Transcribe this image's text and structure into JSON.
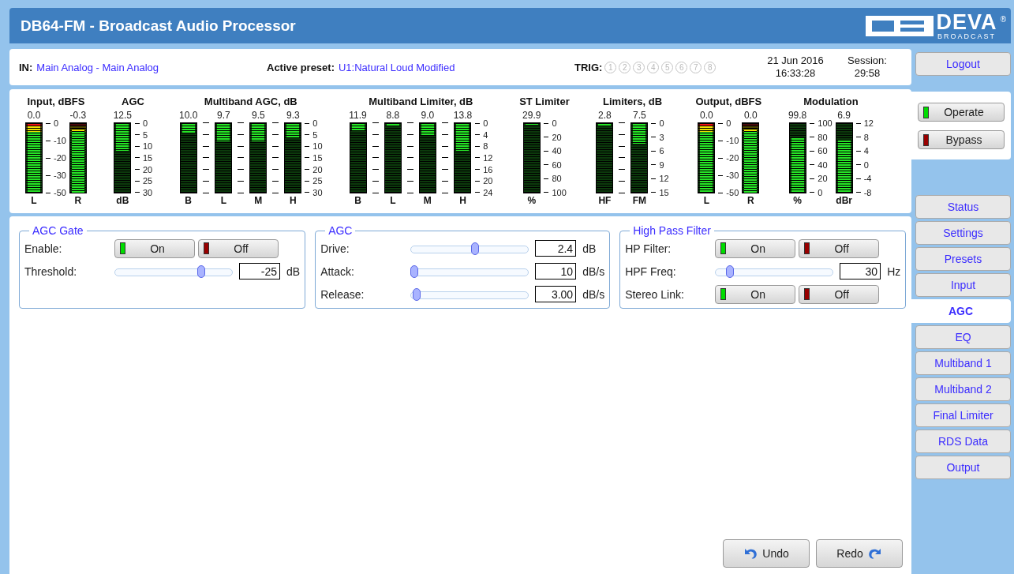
{
  "window": {
    "title": "DB64-FM - Broadcast Audio Processor"
  },
  "logo": {
    "name": "DEVA",
    "registered": "®",
    "tagline": "BROADCAST"
  },
  "info": {
    "input_label": "IN:",
    "input_value": "Main Analog - Main Analog",
    "preset_label": "Active preset:",
    "preset_value": "U1:Natural Loud Modified",
    "trig_label": "TRIG:",
    "triggers": [
      {
        "label": "1",
        "disabled": true
      },
      {
        "label": "2",
        "disabled": true
      },
      {
        "label": "3",
        "disabled": true
      },
      {
        "label": "4",
        "disabled": true
      },
      {
        "label": "5",
        "disabled": true
      },
      {
        "label": "6",
        "disabled": true
      },
      {
        "label": "7",
        "disabled": true
      },
      {
        "label": "8",
        "disabled": true
      }
    ],
    "date": "21 Jun 2016",
    "time": "16:33:28",
    "session_label": "Session:",
    "session_value": "29:58"
  },
  "meters": [
    {
      "title": "Input, dBFS",
      "columns": [
        {
          "kind": "clip",
          "value": "0.0",
          "label": "L",
          "level": 1.0
        },
        {
          "kind": "scale",
          "labels": [
            "0",
            "-10",
            "-20",
            "-30",
            "-50"
          ]
        },
        {
          "kind": "clip",
          "value": "-0.3",
          "label": "R",
          "level": 0.92
        }
      ]
    },
    {
      "title": "AGC",
      "columns": [
        {
          "kind": "drop",
          "value": "12.5",
          "label": "dB",
          "level": 0.4
        },
        {
          "kind": "scale",
          "labels": [
            "0",
            "5",
            "10",
            "15",
            "20",
            "25",
            "30"
          ]
        }
      ]
    },
    {
      "title": "Multiband AGC, dB",
      "columns": [
        {
          "kind": "drop",
          "value": "10.0",
          "label": "B",
          "level": 0.14
        },
        {
          "kind": "ticks"
        },
        {
          "kind": "drop",
          "value": "9.7",
          "label": "L",
          "level": 0.26
        },
        {
          "kind": "ticks"
        },
        {
          "kind": "drop",
          "value": "9.5",
          "label": "M",
          "level": 0.26
        },
        {
          "kind": "ticks"
        },
        {
          "kind": "drop",
          "value": "9.3",
          "label": "H",
          "level": 0.2
        },
        {
          "kind": "scale",
          "labels": [
            "0",
            "5",
            "10",
            "15",
            "20",
            "25",
            "30"
          ]
        }
      ]
    },
    {
      "title": "Multiband Limiter, dB",
      "columns": [
        {
          "kind": "drop",
          "value": "11.9",
          "label": "B",
          "level": 0.1
        },
        {
          "kind": "ticks"
        },
        {
          "kind": "drop",
          "value": "8.8",
          "label": "L",
          "level": 0.03
        },
        {
          "kind": "ticks"
        },
        {
          "kind": "drop",
          "value": "9.0",
          "label": "M",
          "level": 0.17
        },
        {
          "kind": "ticks"
        },
        {
          "kind": "drop",
          "value": "13.8",
          "label": "H",
          "level": 0.4
        },
        {
          "kind": "scale",
          "labels": [
            "0",
            "4",
            "8",
            "12",
            "16",
            "20",
            "24"
          ]
        }
      ]
    },
    {
      "title": "ST Limiter",
      "columns": [
        {
          "kind": "drop",
          "value": "29.9",
          "label": "%",
          "level": 0.02
        },
        {
          "kind": "scale",
          "labels": [
            "0",
            "20",
            "40",
            "60",
            "80",
            "100"
          ]
        }
      ]
    },
    {
      "title": "Limiters, dB",
      "columns": [
        {
          "kind": "drop",
          "value": "2.8",
          "label": "HF",
          "level": 0.05
        },
        {
          "kind": "ticks"
        },
        {
          "kind": "drop",
          "value": "7.5",
          "label": "FM",
          "level": 0.3
        },
        {
          "kind": "scale",
          "labels": [
            "0",
            "3",
            "6",
            "9",
            "12",
            "15"
          ]
        }
      ]
    },
    {
      "title": "Output, dBFS",
      "columns": [
        {
          "kind": "clip",
          "value": "0.0",
          "label": "L",
          "level": 1.0
        },
        {
          "kind": "scale",
          "labels": [
            "0",
            "-10",
            "-20",
            "-30",
            "-50"
          ]
        },
        {
          "kind": "clip",
          "value": "0.0",
          "label": "R",
          "level": 0.92
        }
      ]
    },
    {
      "title": "Modulation",
      "columns": [
        {
          "kind": "rise",
          "value": "99.8",
          "label": "%",
          "level": 0.8
        },
        {
          "kind": "scale",
          "labels": [
            "100",
            "80",
            "60",
            "40",
            "20",
            "0"
          ]
        },
        {
          "kind": "rise",
          "value": "6.9",
          "label": "dBr",
          "level": 0.76
        },
        {
          "kind": "scale",
          "labels": [
            "12",
            "8",
            "4",
            "0",
            "-4",
            "-8"
          ]
        }
      ]
    }
  ],
  "sections": [
    {
      "title": "AGC Gate",
      "rows": [
        {
          "kind": "toggle",
          "label": "Enable:",
          "options": [
            {
              "label": "On",
              "color": "#00dd00"
            },
            {
              "label": "Off",
              "color": "#990000"
            }
          ]
        },
        {
          "kind": "slider",
          "label": "Threshold:",
          "level": 0.75,
          "value": "-25",
          "unit": "dB"
        }
      ]
    },
    {
      "title": "AGC",
      "rows": [
        {
          "kind": "slider",
          "label": "Drive:",
          "level": 0.55,
          "value": "2.4",
          "unit": "dB"
        },
        {
          "kind": "slider",
          "label": "Attack:",
          "level": 0.0,
          "value": "10",
          "unit": "dB/s"
        },
        {
          "kind": "slider",
          "label": "Release:",
          "level": 0.02,
          "value": "3.00",
          "unit": "dB/s"
        }
      ]
    },
    {
      "title": "High Pass Filter",
      "rows": [
        {
          "kind": "toggle",
          "label": "HP Filter:",
          "options": [
            {
              "label": "On",
              "color": "#00dd00"
            },
            {
              "label": "Off",
              "color": "#990000"
            }
          ]
        },
        {
          "kind": "slider",
          "label": "HPF Freq:",
          "level": 0.1,
          "value": "30",
          "unit": "Hz"
        },
        {
          "kind": "toggle",
          "label": "Stereo Link:",
          "options": [
            {
              "label": "On",
              "color": "#00dd00"
            },
            {
              "label": "Off",
              "color": "#990000"
            }
          ]
        }
      ]
    }
  ],
  "actions": [
    {
      "kind": "undo",
      "label": "Undo"
    },
    {
      "kind": "redo",
      "label": "Redo"
    }
  ],
  "sidebar": {
    "logout": "Logout",
    "modes": [
      {
        "label": "Operate",
        "color": "#00dd00"
      },
      {
        "label": "Bypass",
        "color": "#990000"
      }
    ],
    "tabs": [
      {
        "label": "Status",
        "selected": false
      },
      {
        "label": "Settings",
        "selected": false
      },
      {
        "label": "Presets",
        "selected": false
      },
      {
        "label": "Input",
        "selected": false
      },
      {
        "label": "AGC",
        "selected": true
      },
      {
        "label": "EQ",
        "selected": false
      },
      {
        "label": "Multiband 1",
        "selected": false
      },
      {
        "label": "Multiband 2",
        "selected": false
      },
      {
        "label": "Final Limiter",
        "selected": false
      },
      {
        "label": "RDS Data",
        "selected": false
      },
      {
        "label": "Output",
        "selected": false
      }
    ]
  }
}
